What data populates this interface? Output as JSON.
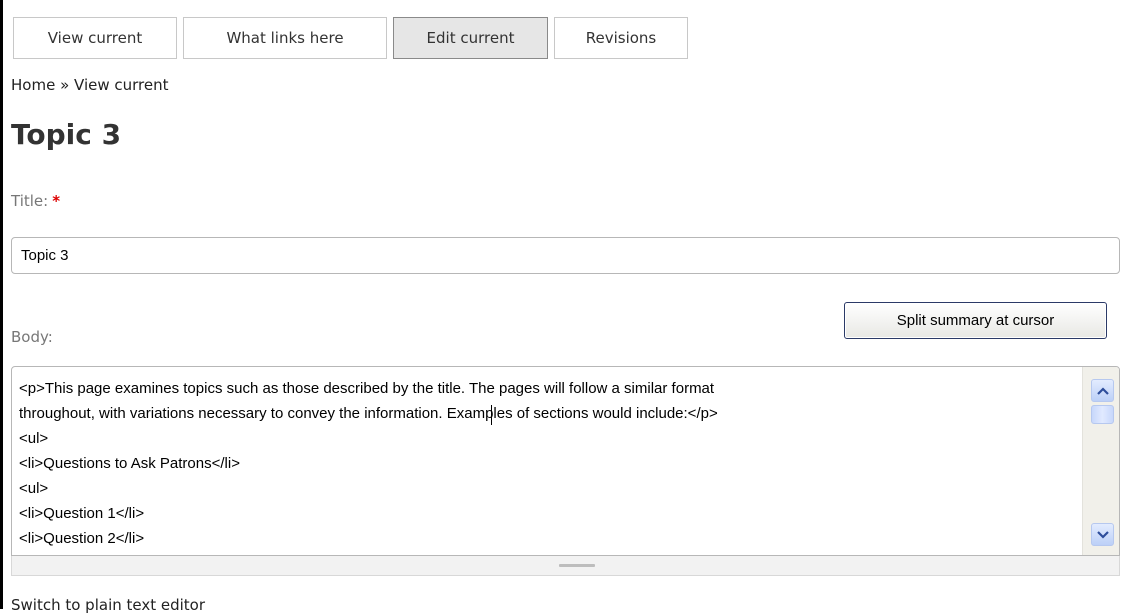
{
  "tabs": [
    {
      "label": "View current",
      "active": false
    },
    {
      "label": "What links here",
      "active": false
    },
    {
      "label": "Edit current",
      "active": true
    },
    {
      "label": "Revisions",
      "active": false
    }
  ],
  "breadcrumb": "Home » View current",
  "page_title": "Topic 3",
  "form": {
    "title_label": "Title:",
    "required_mark": "*",
    "title_value": "Topic 3",
    "body_label": "Body:",
    "split_button_label": "Split summary at cursor",
    "body_value": "<p>This page examines topics such as those described by the title. The pages will follow a similar format\nthroughout, with variations necessary to convey the information. Examples of sections would include:</p>\n<ul>\n<li>Questions to Ask Patrons</li>\n<ul>\n<li>Question 1</li>\n<li>Question 2</li>",
    "switch_editor_link": "Switch to plain text editor"
  },
  "icons": {
    "scroll_up": "chevron-up-icon",
    "scroll_down": "chevron-down-icon"
  },
  "colors": {
    "active_tab_bg": "#e6e6e6",
    "required": "#dd0000",
    "scrollbar_button": "#bcd0f7"
  }
}
